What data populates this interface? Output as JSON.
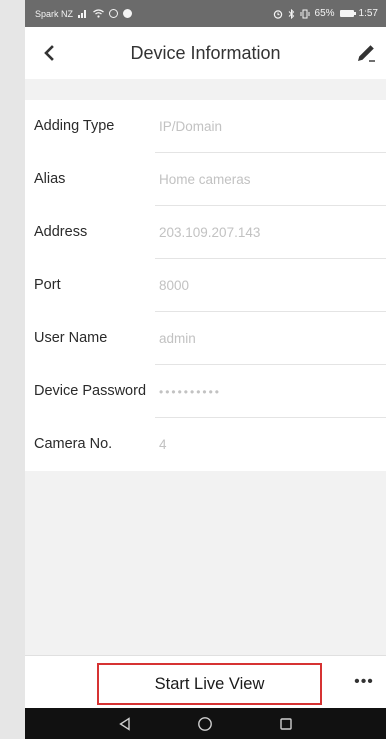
{
  "status_bar": {
    "carrier": "Spark NZ",
    "indicators": "⌛✱ ‖‖‖",
    "battery": "65%",
    "time": "1:57"
  },
  "header": {
    "title": "Device Information",
    "back_icon": "chevron-left-icon",
    "edit_icon": "pencil-icon"
  },
  "form": {
    "rows": [
      {
        "label": "Adding Type",
        "value": "IP/Domain"
      },
      {
        "label": "Alias",
        "value": "Home cameras"
      },
      {
        "label": "Address",
        "value": "203.109.207.143"
      },
      {
        "label": "Port",
        "value": "8000"
      },
      {
        "label": "User Name",
        "value": "admin"
      },
      {
        "label": "Device Password",
        "value": "••••••••••"
      },
      {
        "label": "Camera No.",
        "value": "4"
      }
    ]
  },
  "bottom_bar": {
    "primary_label": "Start Live View",
    "more_label": "•••"
  },
  "colors": {
    "highlight": "#d63232",
    "placeholder": "#c2c2c2"
  }
}
